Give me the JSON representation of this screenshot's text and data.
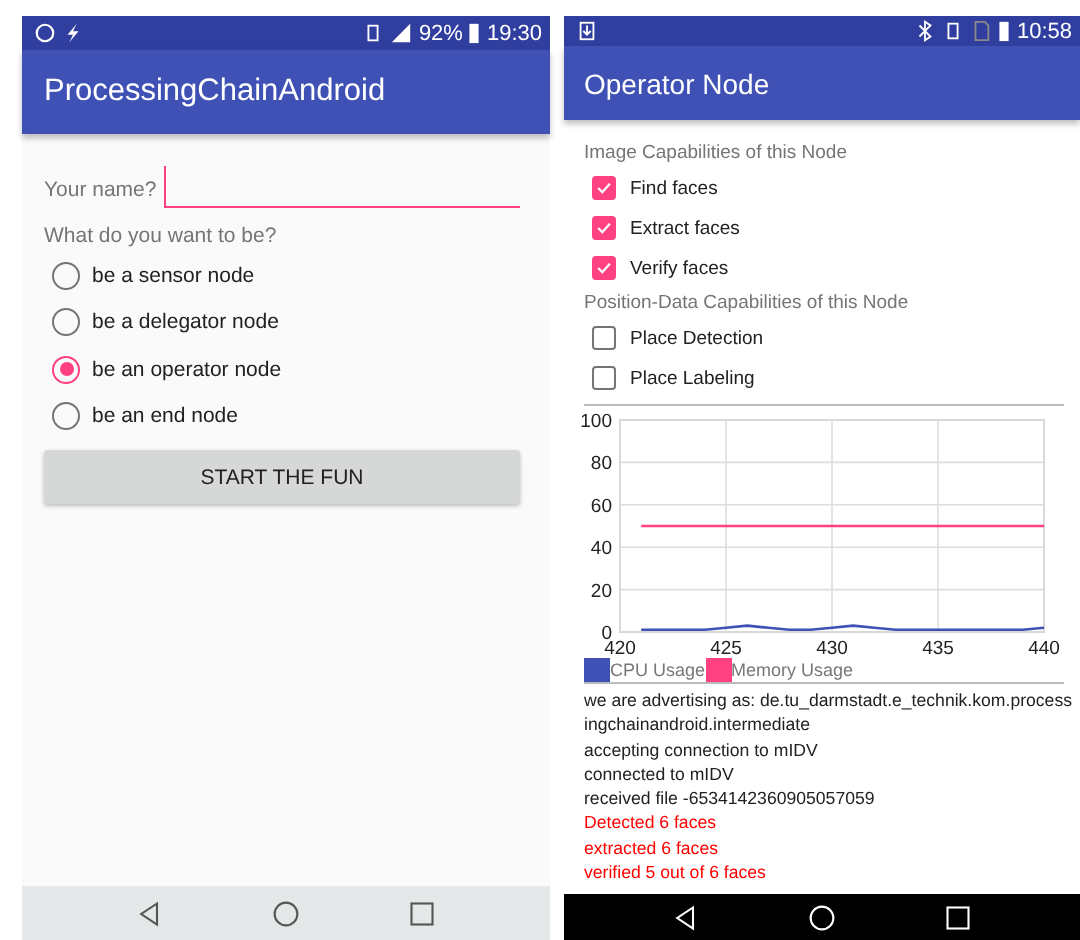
{
  "left_screen": {
    "status_bar": {
      "battery": "92%",
      "time": "19:30"
    },
    "app_bar": {
      "title": "ProcessingChainAndroid"
    },
    "name_field": {
      "label": "Your name?"
    },
    "role_prompt": "What do you want to be?",
    "roles": [
      {
        "label": "be a sensor node",
        "selected": false
      },
      {
        "label": "be a delegator node",
        "selected": false
      },
      {
        "label": "be an operator node",
        "selected": true
      },
      {
        "label": "be an end node",
        "selected": false
      }
    ],
    "start_button": "START THE FUN"
  },
  "right_screen": {
    "status_bar": {
      "time": "10:58"
    },
    "app_bar": {
      "title": "Operator Node"
    },
    "sections": [
      {
        "heading": "Image Capabilities of this Node",
        "options": [
          {
            "label": "Find faces",
            "checked": true
          },
          {
            "label": "Extract faces",
            "checked": true
          },
          {
            "label": "Verify faces",
            "checked": true
          }
        ]
      },
      {
        "heading": "Position-Data Capabilities of this Node",
        "options": [
          {
            "label": "Place Detection",
            "checked": false
          },
          {
            "label": "Place Labeling",
            "checked": false
          }
        ]
      }
    ],
    "chart_data": {
      "type": "line",
      "x": [
        421,
        422,
        423,
        424,
        425,
        426,
        427,
        428,
        429,
        430,
        431,
        432,
        433,
        434,
        435,
        436,
        437,
        438,
        439,
        440
      ],
      "series": [
        {
          "name": "CPU Usage",
          "color": "#3f51b5",
          "values": [
            1,
            1,
            1,
            1,
            2,
            3,
            2,
            1,
            1,
            2,
            3,
            2,
            1,
            1,
            1,
            1,
            1,
            1,
            1,
            2
          ]
        },
        {
          "name": "Memory Usage",
          "color": "#ff4081",
          "values": [
            50,
            50,
            50,
            50,
            50,
            50,
            50,
            50,
            50,
            50,
            50,
            50,
            50,
            50,
            50,
            50,
            50,
            50,
            50,
            50
          ]
        }
      ],
      "grid": true,
      "legend": true,
      "xlim": [
        420,
        440
      ],
      "ylim": [
        0,
        100
      ],
      "xticks": [
        420,
        425,
        430,
        435,
        440
      ],
      "yticks": [
        0,
        20,
        40,
        60,
        80,
        100
      ]
    },
    "log": [
      {
        "text": "we are advertising as: de.tu_darmstadt.e_technik.kom.processingchainandroid.intermediate",
        "color": "#212121"
      },
      {
        "text": "accepting connection to mIDV",
        "color": "#212121"
      },
      {
        "text": "connected to mIDV",
        "color": "#212121"
      },
      {
        "text": "received file -6534142360905057059",
        "color": "#212121"
      },
      {
        "text": "Detected 6 faces",
        "color": "#ff0000"
      },
      {
        "text": "extracted 6 faces",
        "color": "#ff0000"
      },
      {
        "text": "verified 5 out of 6 faces",
        "color": "#ff0000"
      }
    ]
  }
}
